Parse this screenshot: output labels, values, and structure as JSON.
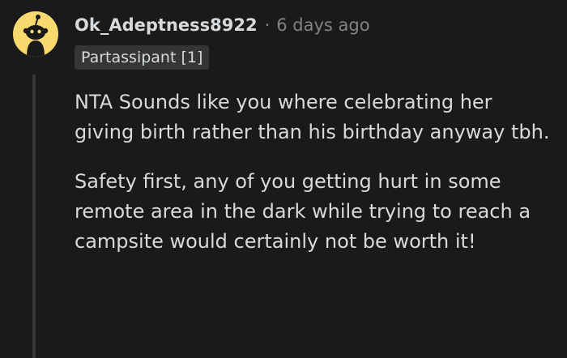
{
  "comment": {
    "username": "Ok_Adeptness8922",
    "separator": "·",
    "timestamp": "6 days ago",
    "flair": "Partassipant [1]",
    "paragraphs": [
      "NTA Sounds like you where celebrating her giving birth rather than his birthday anyway tbh.",
      "Safety first, any of you getting hurt in some remote area in the dark while trying to reach a campsite would certainly not be worth it!"
    ],
    "avatar_icon": "reddit-snoo-icon",
    "colors": {
      "background": "#1a1a1b",
      "avatar_bg": "#f8d96e",
      "text": "#d7dadc",
      "muted": "#818384",
      "flair_bg": "#343536",
      "thread_line": "#343536"
    }
  }
}
